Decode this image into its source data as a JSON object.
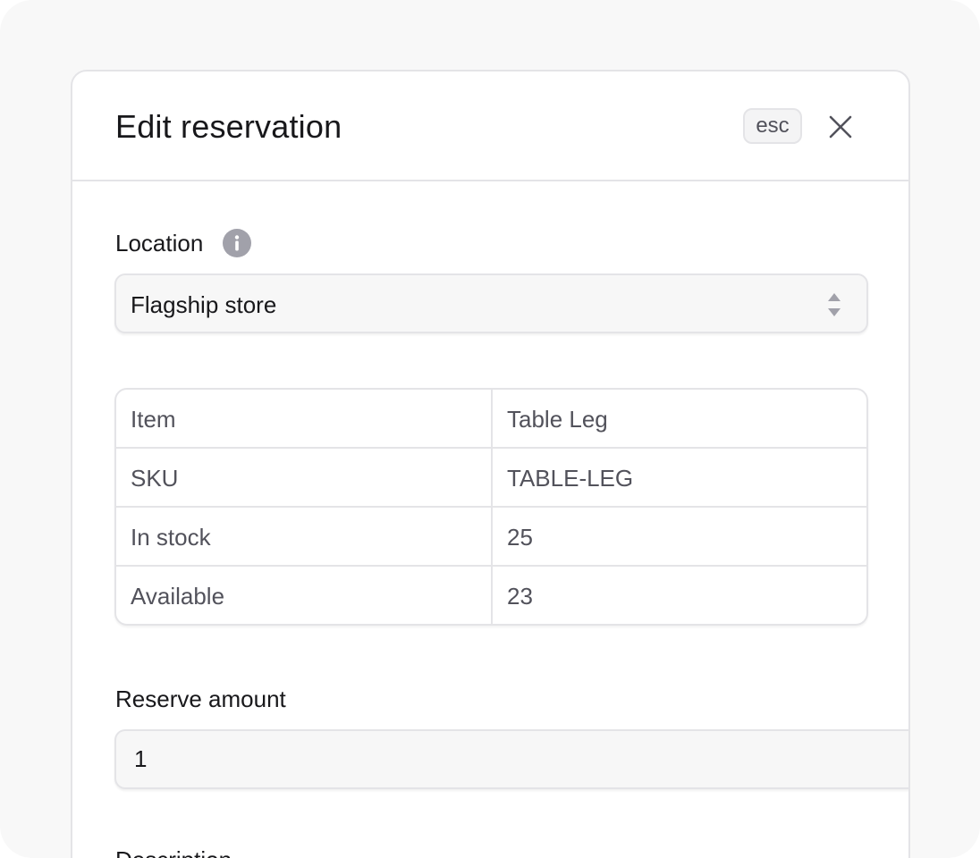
{
  "drawer": {
    "title": "Edit reservation",
    "esc_hint": "esc",
    "close_icon": "close-icon"
  },
  "location": {
    "label": "Location",
    "info_icon": "info-icon",
    "selected": "Flagship store"
  },
  "details": {
    "rows": [
      {
        "key": "Item",
        "value": "Table Leg"
      },
      {
        "key": "SKU",
        "value": "TABLE-LEG"
      },
      {
        "key": "In stock",
        "value": "25"
      },
      {
        "key": "Available",
        "value": "23"
      }
    ]
  },
  "reserve": {
    "label": "Reserve amount",
    "value": "1"
  },
  "description": {
    "label": "Description"
  },
  "colors": {
    "background": "#f8f8f8",
    "border": "#e4e4e7",
    "input_bg": "#f7f7f7",
    "text_primary": "#18181b",
    "text_secondary": "#52525b",
    "icon_gray": "#a1a1aa"
  }
}
